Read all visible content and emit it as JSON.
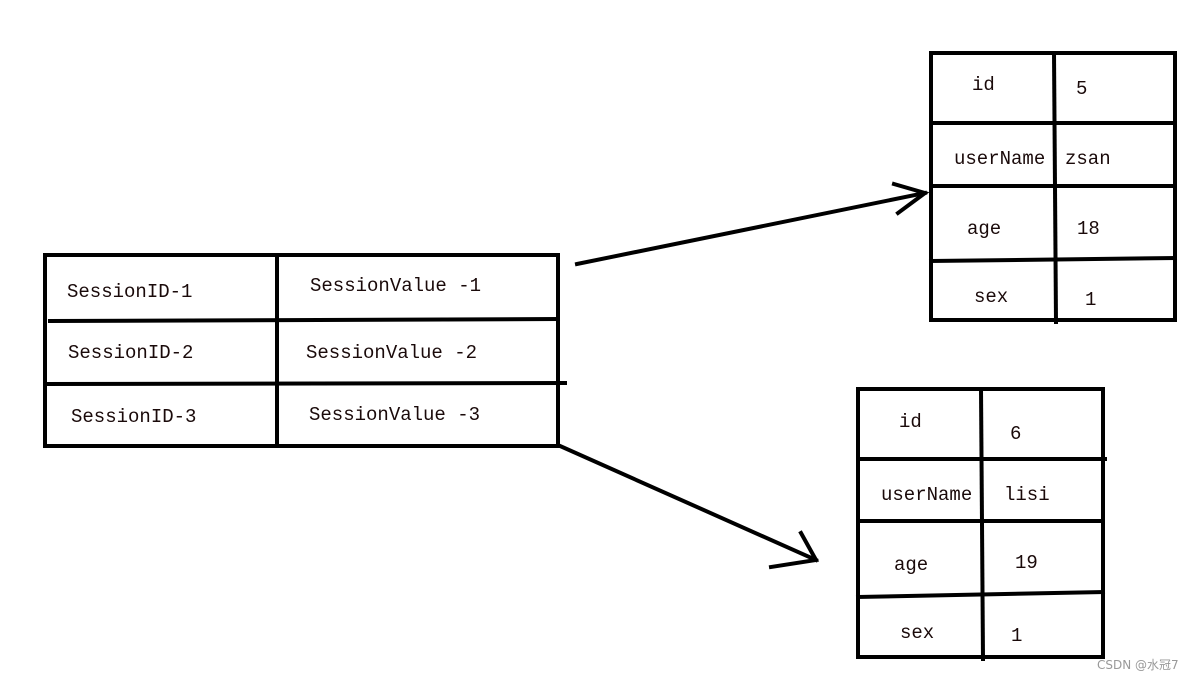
{
  "session_table": {
    "rows": [
      {
        "id": "SessionID-1",
        "value": "SessionValue -1"
      },
      {
        "id": "SessionID-2",
        "value": "SessionValue -2"
      },
      {
        "id": "SessionID-3",
        "value": "SessionValue -3"
      }
    ]
  },
  "user_tables": [
    {
      "rows": [
        {
          "key": "id",
          "value": "5"
        },
        {
          "key": "userName",
          "value": "zsan"
        },
        {
          "key": "age",
          "value": "18"
        },
        {
          "key": "sex",
          "value": "1"
        }
      ]
    },
    {
      "rows": [
        {
          "key": "id",
          "value": "6"
        },
        {
          "key": "userName",
          "value": "lisi"
        },
        {
          "key": "age",
          "value": "19"
        },
        {
          "key": "sex",
          "value": "1"
        }
      ]
    }
  ],
  "watermark": "CSDN @水冠7"
}
